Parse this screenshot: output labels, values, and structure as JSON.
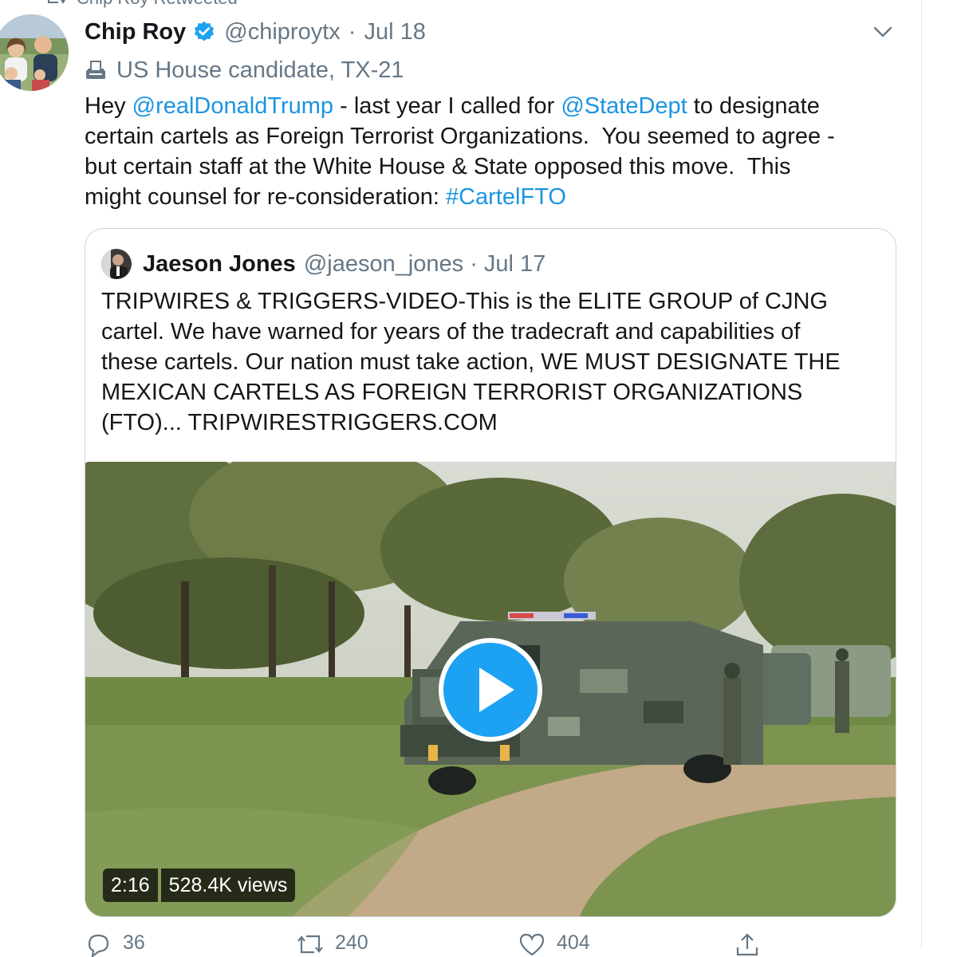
{
  "retweet_header": {
    "text": "Chip Roy Retweeted"
  },
  "tweet": {
    "author_name": "Chip Roy",
    "handle": "@chiproytx",
    "separator": "·",
    "date": "Jul 18",
    "label": "US House candidate, TX-21",
    "text_lines": [
      [
        {
          "t": "Hey "
        },
        {
          "t": "@realDonaldTrump",
          "link": true
        },
        {
          "t": " - last year I called for "
        },
        {
          "t": "@StateDept",
          "link": true
        },
        {
          "t": " to designate"
        }
      ],
      [
        {
          "t": "certain cartels as Foreign Terrorist Organizations.  You seemed to agree -"
        }
      ],
      [
        {
          "t": "but certain staff at the White House & State opposed this move.  This"
        }
      ],
      [
        {
          "t": "might counsel for re-consideration: "
        },
        {
          "t": "#CartelFTO",
          "link": true
        }
      ]
    ]
  },
  "quoted_tweet": {
    "author_name": "Jaeson Jones",
    "handle": "@jaeson_jones",
    "separator": "·",
    "date": "Jul 17",
    "text_lines": [
      "TRIPWIRES & TRIGGERS-VIDEO-This is the ELITE GROUP of CJNG",
      "cartel. We have warned for years of the tradecraft and capabilities of",
      "these cartels. Our nation must take action, WE MUST DESIGNATE THE",
      "MEXICAN CARTELS AS FOREIGN TERRORIST ORGANIZATIONS",
      "(FTO)... TRIPWIRESTRIGGERS.COM"
    ],
    "video": {
      "duration": "2:16",
      "views": "528.4K views"
    }
  },
  "actions": {
    "reply_count": "36",
    "retweet_count": "240",
    "like_count": "404"
  },
  "colors": {
    "link": "#1b95e0",
    "muted": "#657786",
    "text": "#14171a",
    "border": "#ccd6dd",
    "play": "#1da1f2"
  },
  "icons": [
    "retweet-icon",
    "verified-badge-icon",
    "chevron-down-icon",
    "ballot-box-icon",
    "play-icon",
    "reply-icon",
    "like-icon",
    "share-icon"
  ]
}
